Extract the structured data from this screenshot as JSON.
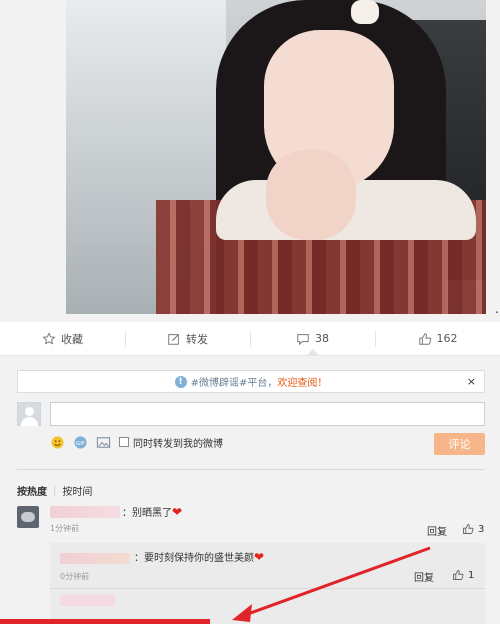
{
  "post": {
    "actions": {
      "favorite_label": "收藏",
      "repost_label": "转发",
      "comment_count": "38",
      "like_count": "162"
    }
  },
  "comment_box": {
    "notice_topic": "#微博辟谣#平台，",
    "notice_welcome": "欢迎查阅！",
    "close": "×",
    "input_placeholder": "",
    "repost_checkbox_label": "同时转发到我的微博",
    "submit_label": "评论"
  },
  "sort": {
    "by_hot": "按热度",
    "by_time": "按时间"
  },
  "comments": [
    {
      "text": "：别晒黑了",
      "time": "1分钟前",
      "reply_label": "回复",
      "likes": "3",
      "replies": [
        {
          "text": "：要时刻保持你的盛世美颜",
          "time": "0分钟前",
          "reply_label": "回复",
          "likes": "1"
        }
      ]
    }
  ],
  "colors": {
    "accent_orange": "#f7b68a",
    "welcome_text": "#e8580c",
    "annotation_red": "#e0242a",
    "heart": "#e1251b"
  },
  "icons": {
    "favorite": "star-icon",
    "repost": "edit-share-icon",
    "comment": "comment-bubble-icon",
    "like": "thumbs-up-icon",
    "emoji": "smiley-icon",
    "gif": "gif-icon",
    "image": "image-icon",
    "info": "info-icon"
  }
}
